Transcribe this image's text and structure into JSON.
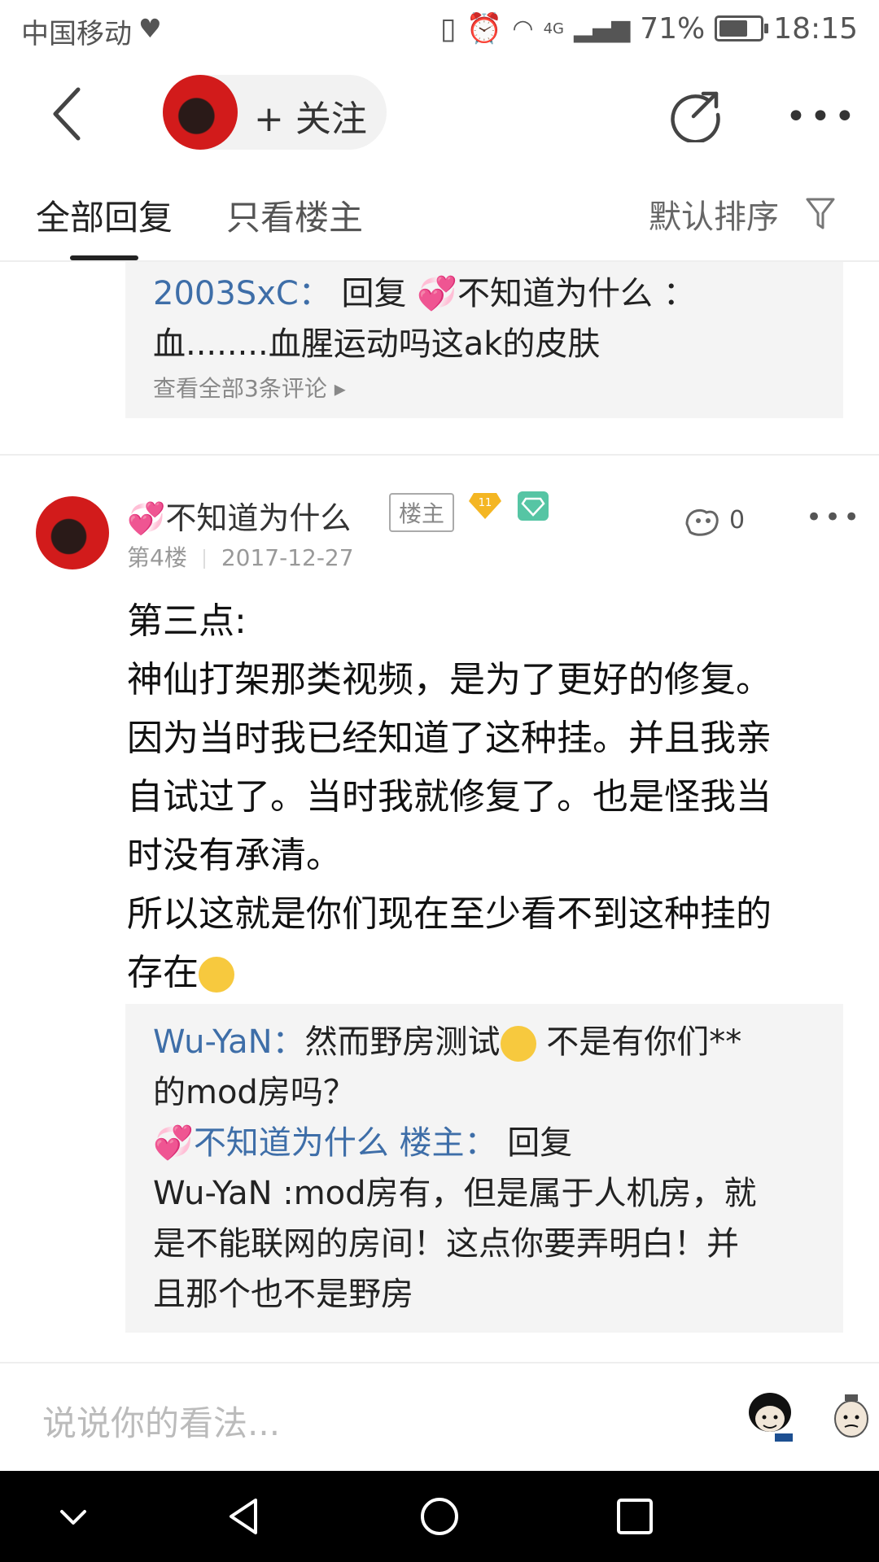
{
  "status_bar": {
    "carrier": "中国移动",
    "network": "4G",
    "battery": "71%",
    "battery_level": 0.71,
    "time": "18:15"
  },
  "header": {
    "follow_label": "+ 关注"
  },
  "tabs": {
    "all_replies": "全部回复",
    "only_op": "只看楼主",
    "sort": "默认排序"
  },
  "prev_floor": {
    "reply_user": "2003SxC：",
    "reply_text_prefix": "回复",
    "reply_target": "不知道为什么 ：",
    "reply_line2": "血........血腥运动吗这ak的皮肤",
    "view_all": "查看全部3条评论"
  },
  "post": {
    "username": "不知道为什么",
    "op_tag": "楼主",
    "level": "11",
    "floor": "第4楼",
    "date": "2017-12-27",
    "likes": "0",
    "body": [
      "第三点:",
      "神仙打架那类视频，是为了更好的修复。",
      "因为当时我已经知道了这种挂。并且我亲",
      "自试过了。当时我就修复了。也是怪我当",
      "时没有承清。",
      "所以这就是你们现在至少看不到这种挂的",
      "存在"
    ]
  },
  "sub_replies": {
    "r1_user": "Wu-YaN：",
    "r1_line1_a": "然而野房测试",
    "r1_line1_b": " 不是有你们**",
    "r1_line2": "的mod房吗？",
    "r2_user": "不知道为什么 楼主：",
    "r2_prefix": "回复",
    "r2_lines": [
      "Wu-YaN :mod房有，但是属于人机房，就",
      "是不能联网的房间！这点你要弄明白！并",
      "且那个也不是野房"
    ]
  },
  "comment_bar": {
    "placeholder": "说说你的看法..."
  }
}
